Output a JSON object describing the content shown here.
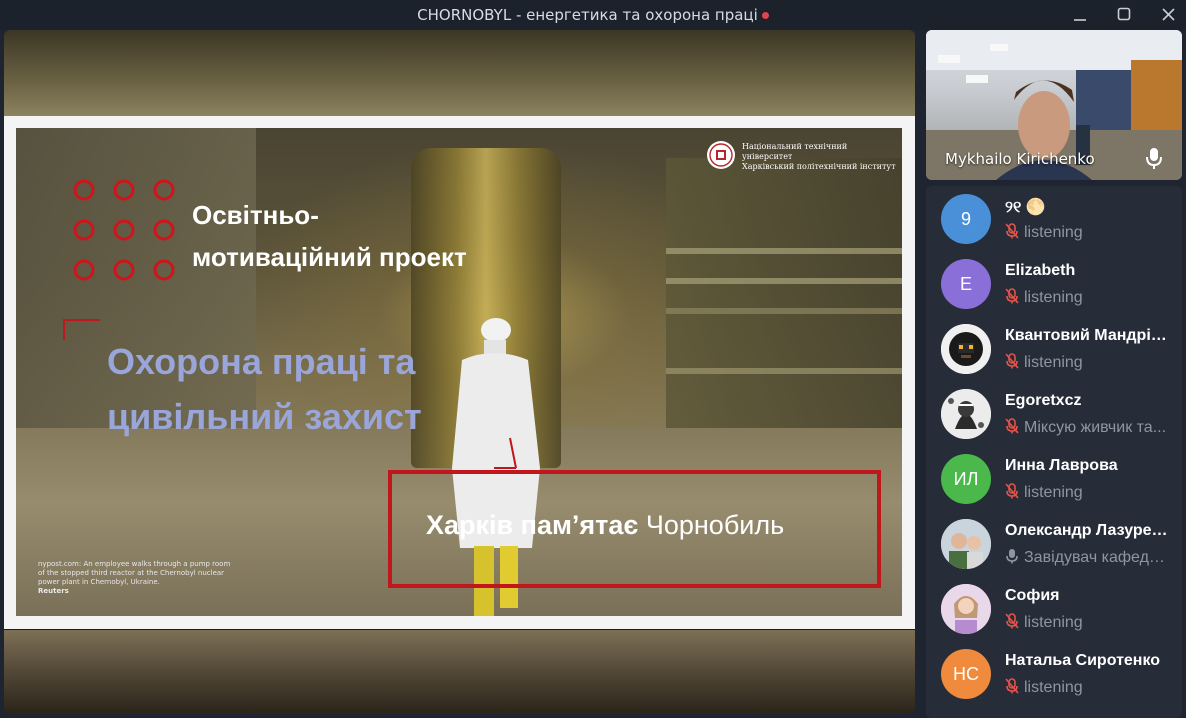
{
  "window": {
    "title": "CHORNOBYL - енергетика та охорона праці",
    "recording_color": "#e0444f"
  },
  "slide": {
    "logo_line1": "Національний технічний університет",
    "logo_line2": "Харківський політехнічний інститут",
    "heading_line1": "Освітньо-",
    "heading_line2": "мотиваційний проект",
    "title_line1": "Охорона праці та",
    "title_line2": "цивільний захист",
    "tagline_bold": "Харків пам’ятає",
    "tagline_light": "Чорнобиль",
    "credit_text": "nypost.com: An employee walks through a pump room of the stopped third reactor at the Chernobyl nuclear power plant in Chernobyl, Ukraine.",
    "credit_source": "Reuters",
    "accent_color": "#c0161c"
  },
  "speaker": {
    "name": "Mykhailo Kirichenko",
    "mic_icon": "microphone-icon"
  },
  "participants": [
    {
      "avatar": "9",
      "avatar_color": "#4a90d9",
      "name": "୨୧ 🌕",
      "status": "listening",
      "muted": true
    },
    {
      "avatar": "E",
      "avatar_color": "#8b6fd8",
      "name": "Elizabeth",
      "status": "listening",
      "muted": true
    },
    {
      "avatar": "",
      "avatar_color": "#f0f0f0",
      "name": "Квантовий Мандрівник",
      "status": "listening",
      "muted": true
    },
    {
      "avatar": "",
      "avatar_color": "#e9e9e9",
      "name": "Egoretxcz",
      "status": "Міксую живчик та...",
      "muted": true
    },
    {
      "avatar": "ИЛ",
      "avatar_color": "#4ab84a",
      "name": "Инна Лаврова",
      "status": "listening",
      "muted": true
    },
    {
      "avatar": "",
      "avatar_color": "#c9d4dd",
      "name": "Олександр Лазуренко",
      "status": "Завідувач кафедри...",
      "muted": false
    },
    {
      "avatar": "",
      "avatar_color": "#d7c3d9",
      "name": "София",
      "status": "listening",
      "muted": true
    },
    {
      "avatar": "НС",
      "avatar_color": "#f08a3c",
      "name": "Натальа Сиротенко",
      "status": "listening",
      "muted": true
    }
  ]
}
